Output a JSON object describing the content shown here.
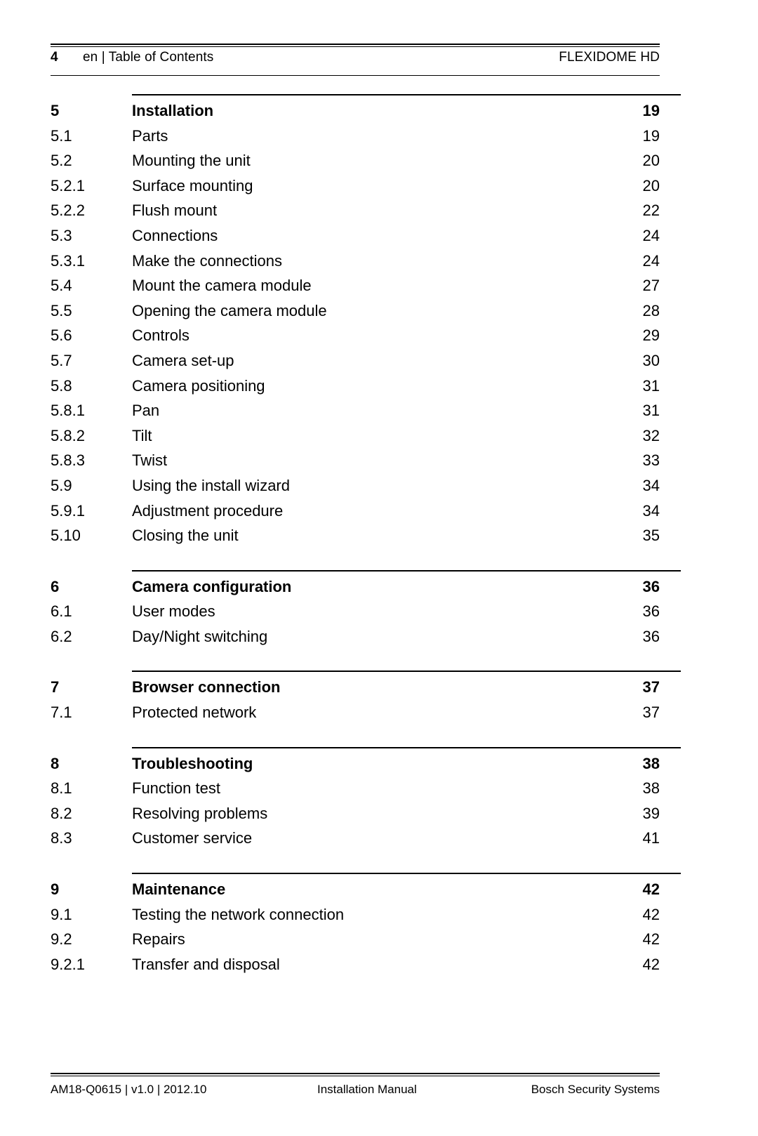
{
  "document": {
    "header": {
      "page_number": "4",
      "breadcrumb": "en | Table of Contents",
      "product": "FLEXIDOME HD"
    },
    "footer": {
      "document_id": "AM18-Q0615 | v1.0 | 2012.10",
      "manual_type": "Installation Manual",
      "company": "Bosch Security Systems"
    }
  },
  "toc": {
    "groups": [
      {
        "entries": [
          {
            "num": "5",
            "title": "Installation",
            "page": "19",
            "level": 1
          },
          {
            "num": "5.1",
            "title": "Parts",
            "page": "19",
            "level": 2
          },
          {
            "num": "5.2",
            "title": "Mounting the unit",
            "page": "20",
            "level": 2
          },
          {
            "num": "5.2.1",
            "title": "Surface mounting",
            "page": "20",
            "level": 3
          },
          {
            "num": "5.2.2",
            "title": "Flush mount",
            "page": "22",
            "level": 3
          },
          {
            "num": "5.3",
            "title": "Connections",
            "page": "24",
            "level": 2
          },
          {
            "num": "5.3.1",
            "title": "Make the connections",
            "page": "24",
            "level": 3
          },
          {
            "num": "5.4",
            "title": "Mount the camera module",
            "page": "27",
            "level": 2
          },
          {
            "num": "5.5",
            "title": "Opening the camera module",
            "page": "28",
            "level": 2
          },
          {
            "num": "5.6",
            "title": "Controls",
            "page": "29",
            "level": 2
          },
          {
            "num": "5.7",
            "title": "Camera set-up",
            "page": "30",
            "level": 2
          },
          {
            "num": "5.8",
            "title": "Camera positioning",
            "page": "31",
            "level": 2
          },
          {
            "num": "5.8.1",
            "title": "Pan",
            "page": "31",
            "level": 3
          },
          {
            "num": "5.8.2",
            "title": "Tilt",
            "page": "32",
            "level": 3
          },
          {
            "num": "5.8.3",
            "title": "Twist",
            "page": "33",
            "level": 3
          },
          {
            "num": "5.9",
            "title": "Using the install wizard",
            "page": "34",
            "level": 2
          },
          {
            "num": "5.9.1",
            "title": "Adjustment procedure",
            "page": "34",
            "level": 3
          },
          {
            "num": "5.10",
            "title": "Closing the unit",
            "page": "35",
            "level": 2
          }
        ]
      },
      {
        "entries": [
          {
            "num": "6",
            "title": "Camera configuration",
            "page": "36",
            "level": 1
          },
          {
            "num": "6.1",
            "title": "User modes",
            "page": "36",
            "level": 2
          },
          {
            "num": "6.2",
            "title": "Day/Night switching",
            "page": "36",
            "level": 2
          }
        ]
      },
      {
        "entries": [
          {
            "num": "7",
            "title": "Browser connection",
            "page": "37",
            "level": 1
          },
          {
            "num": "7.1",
            "title": "Protected network",
            "page": "37",
            "level": 2
          }
        ]
      },
      {
        "entries": [
          {
            "num": "8",
            "title": "Troubleshooting",
            "page": "38",
            "level": 1
          },
          {
            "num": "8.1",
            "title": "Function test",
            "page": "38",
            "level": 2
          },
          {
            "num": "8.2",
            "title": "Resolving problems",
            "page": "39",
            "level": 2
          },
          {
            "num": "8.3",
            "title": "Customer service",
            "page": "41",
            "level": 2
          }
        ]
      },
      {
        "entries": [
          {
            "num": "9",
            "title": "Maintenance",
            "page": "42",
            "level": 1
          },
          {
            "num": "9.1",
            "title": "Testing the network connection",
            "page": "42",
            "level": 2
          },
          {
            "num": "9.2",
            "title": "Repairs",
            "page": "42",
            "level": 2
          },
          {
            "num": "9.2.1",
            "title": "Transfer and disposal",
            "page": "42",
            "level": 3
          }
        ]
      }
    ]
  }
}
